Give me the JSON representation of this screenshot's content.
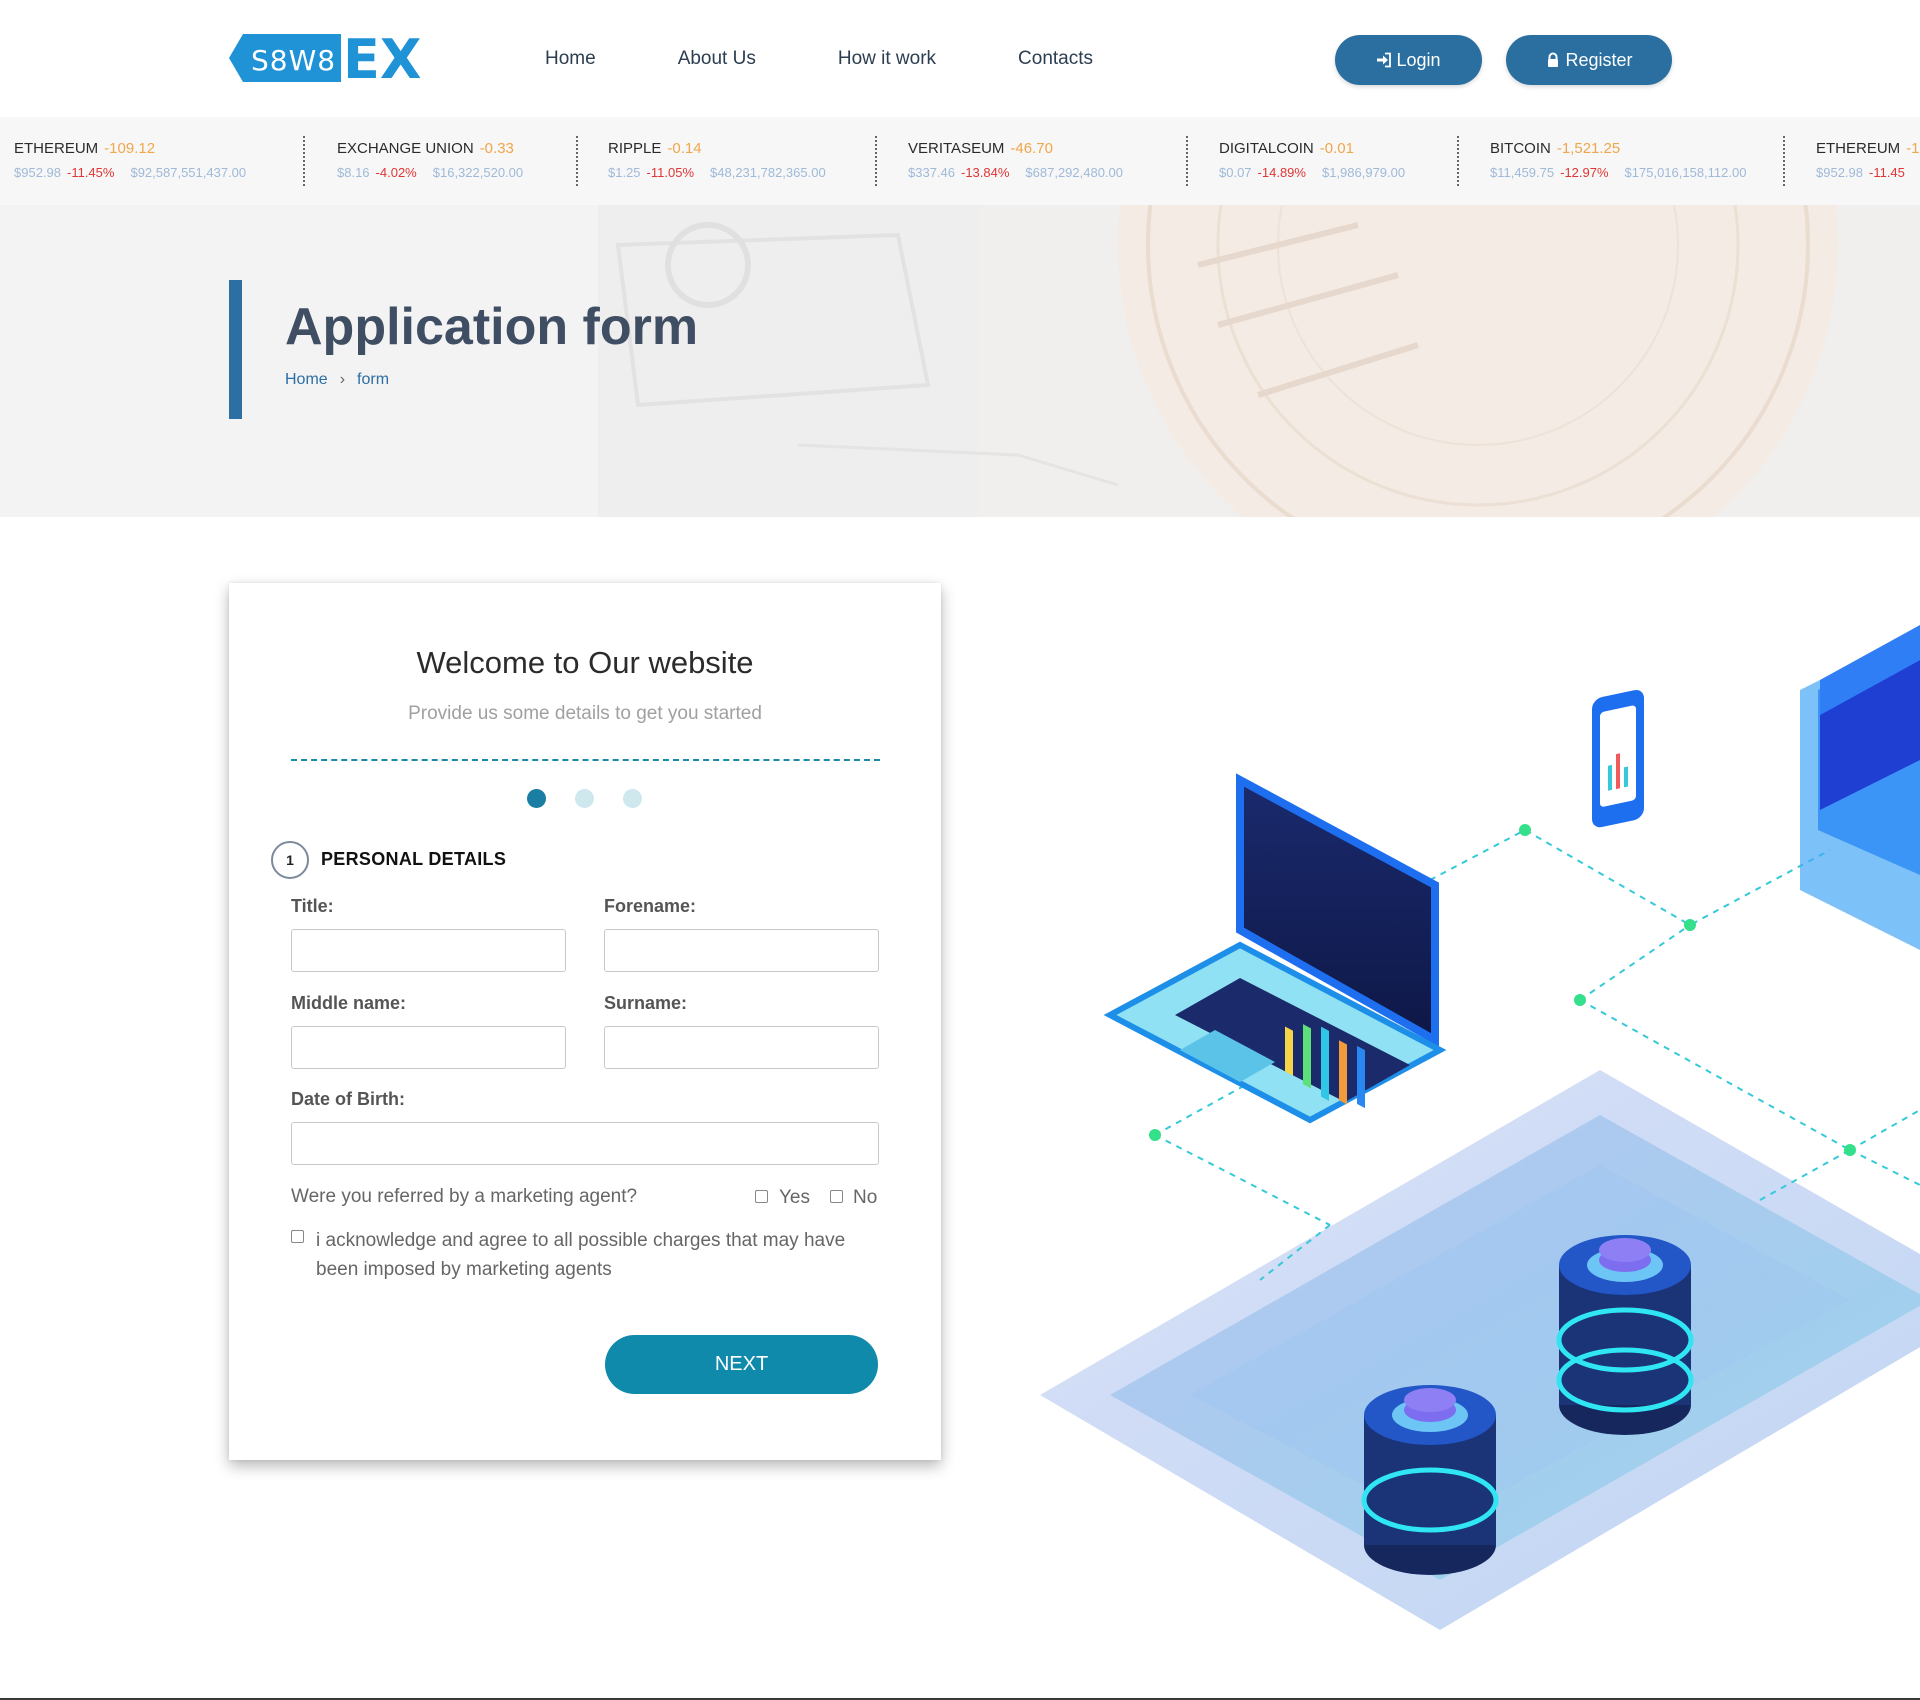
{
  "header": {
    "logo_text": "SAWAEX",
    "nav": [
      "Home",
      "About Us",
      "How it work",
      "Contacts"
    ],
    "login_label": "Login",
    "register_label": "Register",
    "colors": {
      "button": "#2a6f9f",
      "logo_blue": "#1f93d6"
    }
  },
  "ticker": [
    {
      "name": "ETHEREUM",
      "change": "-109.12",
      "price": "$952.98",
      "pct": "-11.45%",
      "cap": "$92,587,551,437.00"
    },
    {
      "name": "EXCHANGE UNION",
      "change": "-0.33",
      "price": "$8.16",
      "pct": "-4.02%",
      "cap": "$16,322,520.00"
    },
    {
      "name": "RIPPLE",
      "change": "-0.14",
      "price": "$1.25",
      "pct": "-11.05%",
      "cap": "$48,231,782,365.00"
    },
    {
      "name": "VERITASEUM",
      "change": "-46.70",
      "price": "$337.46",
      "pct": "-13.84%",
      "cap": "$687,292,480.00"
    },
    {
      "name": "DIGITALCOIN",
      "change": "-0.01",
      "price": "$0.07",
      "pct": "-14.89%",
      "cap": "$1,986,979.00"
    },
    {
      "name": "BITCOIN",
      "change": "-1,521.25",
      "price": "$11,459.75",
      "pct": "-12.97%",
      "cap": "$175,016,158,112.00"
    },
    {
      "name": "ETHEREUM",
      "change": "-1",
      "price": "$952.98",
      "pct": "-11.45",
      "cap": ""
    }
  ],
  "banner": {
    "title": "Application form",
    "breadcrumb_home": "Home",
    "breadcrumb_sep": "›",
    "breadcrumb_current": "form"
  },
  "form": {
    "heading": "Welcome to Our website",
    "subheading": "Provide us some details to get you started",
    "step_number": "1",
    "step_title": "PERSONAL DETAILS",
    "current_step": 1,
    "total_steps": 3,
    "fields": {
      "title_label": "Title:",
      "title_value": "",
      "forename_label": "Forename:",
      "forename_value": "",
      "middle_label": "Middle name:",
      "middle_value": "",
      "surname_label": "Surname:",
      "surname_value": "",
      "dob_label": "Date of Birth:",
      "dob_value": ""
    },
    "referral_question": "Were you referred by a marketing agent?",
    "yes_label": "Yes",
    "no_label": "No",
    "acknowledge_text": "i acknowledge and agree to all possible charges that may have been imposed by marketing agents",
    "next_label": "NEXT",
    "colors": {
      "accent": "#0f8aab",
      "dot_active": "#1a7ea3",
      "dot_inactive": "#cfe8ee"
    }
  },
  "illustration": {
    "description_icons": [
      "laptop-icon",
      "phone-icon",
      "server-cube-icon",
      "coin-stack-icon"
    ]
  }
}
